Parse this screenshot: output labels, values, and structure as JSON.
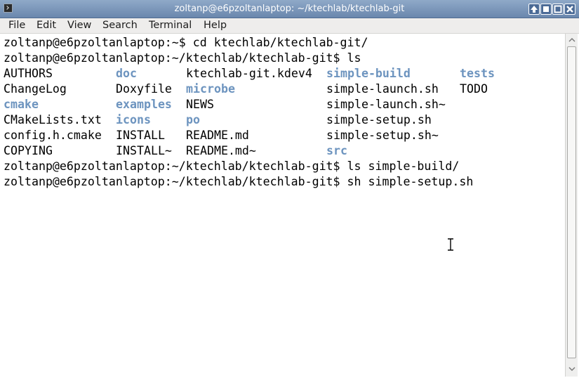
{
  "window": {
    "title": "zoltanp@e6pzoltanlaptop: ~/ktechlab/ktechlab-git",
    "icon": "terminal-icon",
    "buttons": [
      "raise-icon",
      "minimize-icon",
      "maximize-icon",
      "close-icon"
    ]
  },
  "menu": {
    "file": "File",
    "edit": "Edit",
    "view": "View",
    "search": "Search",
    "terminal": "Terminal",
    "help": "Help"
  },
  "colors": {
    "directory": "#6d94bf",
    "titlebar": "#7894b8",
    "text": "#000000"
  },
  "terminal": {
    "prompts": [
      {
        "prompt": "zoltanp@e6pzoltanlaptop:~$ ",
        "command": "cd ktechlab/ktechlab-git/"
      },
      {
        "prompt": "zoltanp@e6pzoltanlaptop:~/ktechlab/ktechlab-git$ ",
        "command": "ls"
      }
    ],
    "ls_rows": [
      [
        "AUTHORS",
        "doc",
        "ktechlab-git.kdev4",
        "simple-build",
        "tests"
      ],
      [
        "ChangeLog",
        "Doxyfile",
        "microbe",
        "simple-launch.sh",
        "TODO"
      ],
      [
        "cmake",
        "examples",
        "NEWS",
        "simple-launch.sh~",
        ""
      ],
      [
        "CMakeLists.txt",
        "icons",
        "po",
        "simple-setup.sh",
        ""
      ],
      [
        "config.h.cmake",
        "INSTALL",
        "README.md",
        "simple-setup.sh~",
        ""
      ],
      [
        "COPYING",
        "INSTALL~",
        "README.md~",
        "src",
        ""
      ]
    ],
    "ls_dirs": [
      [
        false,
        true,
        false,
        true,
        true
      ],
      [
        false,
        false,
        true,
        false,
        false
      ],
      [
        true,
        true,
        false,
        false,
        false
      ],
      [
        false,
        true,
        true,
        false,
        false
      ],
      [
        false,
        false,
        false,
        false,
        false
      ],
      [
        false,
        false,
        false,
        true,
        false
      ]
    ],
    "after": [
      {
        "prompt": "zoltanp@e6pzoltanlaptop:~/ktechlab/ktechlab-git$ ",
        "command": "ls simple-build/"
      },
      {
        "prompt": "zoltanp@e6pzoltanlaptop:~/ktechlab/ktechlab-git$ ",
        "command": "sh simple-setup.sh"
      }
    ]
  }
}
